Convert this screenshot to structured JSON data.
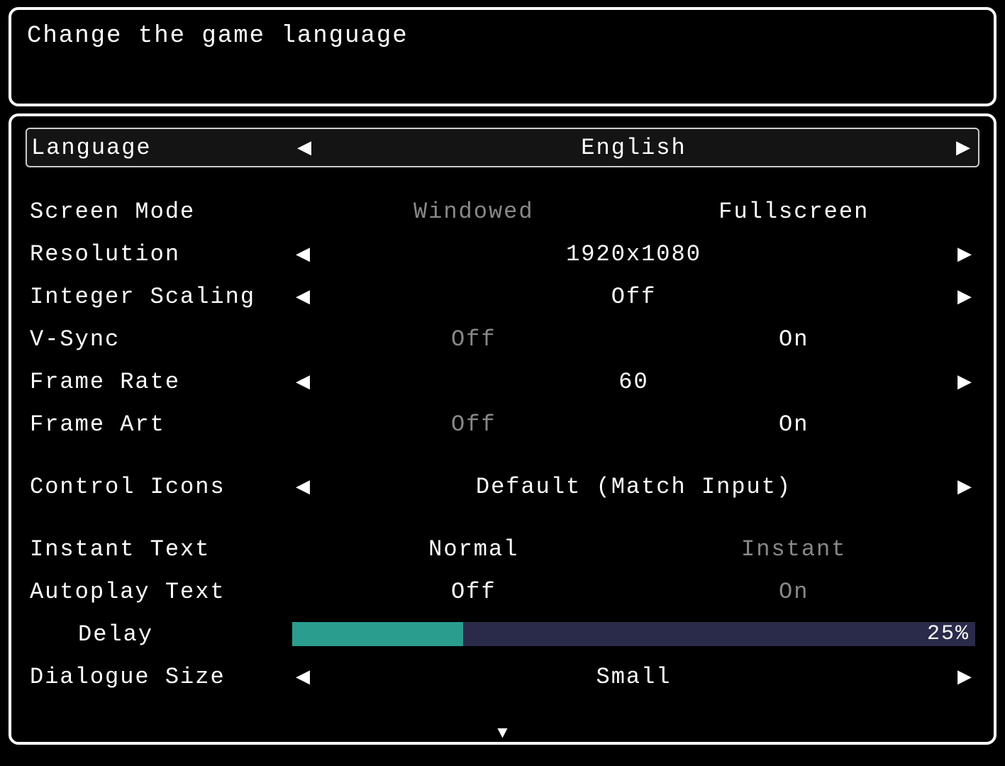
{
  "description": "Change the game language",
  "settings": {
    "language": {
      "label": "Language",
      "value": "English"
    },
    "screen_mode": {
      "label": "Screen Mode",
      "opt_a": "Windowed",
      "opt_b": "Fullscreen",
      "selected": "b"
    },
    "resolution": {
      "label": "Resolution",
      "value": "1920x1080"
    },
    "integer_scaling": {
      "label": "Integer Scaling",
      "value": "Off"
    },
    "vsync": {
      "label": "V-Sync",
      "opt_a": "Off",
      "opt_b": "On",
      "selected": "b"
    },
    "frame_rate": {
      "label": "Frame Rate",
      "value": "60"
    },
    "frame_art": {
      "label": "Frame Art",
      "opt_a": "Off",
      "opt_b": "On",
      "selected": "b"
    },
    "control_icons": {
      "label": "Control Icons",
      "value": "Default (Match Input)"
    },
    "instant_text": {
      "label": "Instant Text",
      "opt_a": "Normal",
      "opt_b": "Instant",
      "selected": "a"
    },
    "autoplay_text": {
      "label": "Autoplay Text",
      "opt_a": "Off",
      "opt_b": "On",
      "selected": "a"
    },
    "delay": {
      "label": "Delay",
      "percent": 25,
      "percent_label": "25%"
    },
    "dialogue_size": {
      "label": "Dialogue Size",
      "value": "Small"
    }
  },
  "glyphs": {
    "arrow_left": "◀",
    "arrow_right": "▶",
    "arrow_down": "▼"
  },
  "colors": {
    "slider_fill": "#2a9d8f",
    "slider_track": "#2a2b4a"
  }
}
